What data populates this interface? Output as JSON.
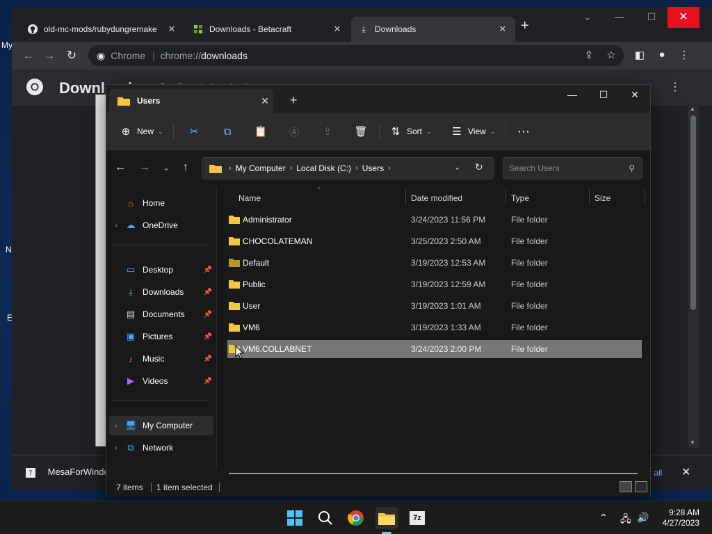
{
  "desktop": {
    "label_my": "My",
    "label_n": "N",
    "label_e": "E"
  },
  "chrome": {
    "tabs": [
      {
        "title": "old-mc-mods/rubydungremake",
        "icon": "github-icon"
      },
      {
        "title": "Downloads - Betacraft",
        "icon": "betacraft-icon"
      },
      {
        "title": "Downloads",
        "icon": "download-icon"
      }
    ],
    "omnibox": {
      "label": "Chrome",
      "url_prefix": "chrome://",
      "url_main": "downloads"
    },
    "page_title": "Downloads",
    "search_placeholder": "Search downloads",
    "shelf": {
      "file": "MesaForWindo",
      "show_all": "r all"
    }
  },
  "explorer": {
    "tab_title": "Users",
    "commands": {
      "new": "New",
      "sort": "Sort",
      "view": "View"
    },
    "breadcrumb": [
      "My Computer",
      "Local Disk (C:)",
      "Users"
    ],
    "search_placeholder": "Search Users",
    "nav": {
      "home": "Home",
      "onedrive": "OneDrive",
      "desktop": "Desktop",
      "downloads": "Downloads",
      "documents": "Documents",
      "pictures": "Pictures",
      "music": "Music",
      "videos": "Videos",
      "my_computer": "My Computer",
      "network": "Network"
    },
    "columns": {
      "name": "Name",
      "date": "Date modified",
      "type": "Type",
      "size": "Size"
    },
    "rows": [
      {
        "name": "Administrator",
        "date": "3/24/2023 11:56 PM",
        "type": "File folder"
      },
      {
        "name": "CHOCOLATEMAN",
        "date": "3/25/2023 2:50 AM",
        "type": "File folder"
      },
      {
        "name": "Default",
        "date": "3/19/2023 12:53 AM",
        "type": "File folder"
      },
      {
        "name": "Public",
        "date": "3/19/2023 12:59 AM",
        "type": "File folder"
      },
      {
        "name": "User",
        "date": "3/19/2023 1:01 AM",
        "type": "File folder"
      },
      {
        "name": "VM6",
        "date": "3/19/2023 1:33 AM",
        "type": "File folder"
      },
      {
        "name": "VM6.COLLABNET",
        "date": "3/24/2023 2:00 PM",
        "type": "File folder"
      }
    ],
    "status": {
      "items": "7 items",
      "selected": "1 item selected"
    }
  },
  "taskbar": {
    "time": "9:28 AM",
    "date": "4/27/2023"
  },
  "colors": {
    "accent": "#60cdff",
    "folder": "#f4c542",
    "close_red": "#e81123",
    "selection": "#777777"
  }
}
